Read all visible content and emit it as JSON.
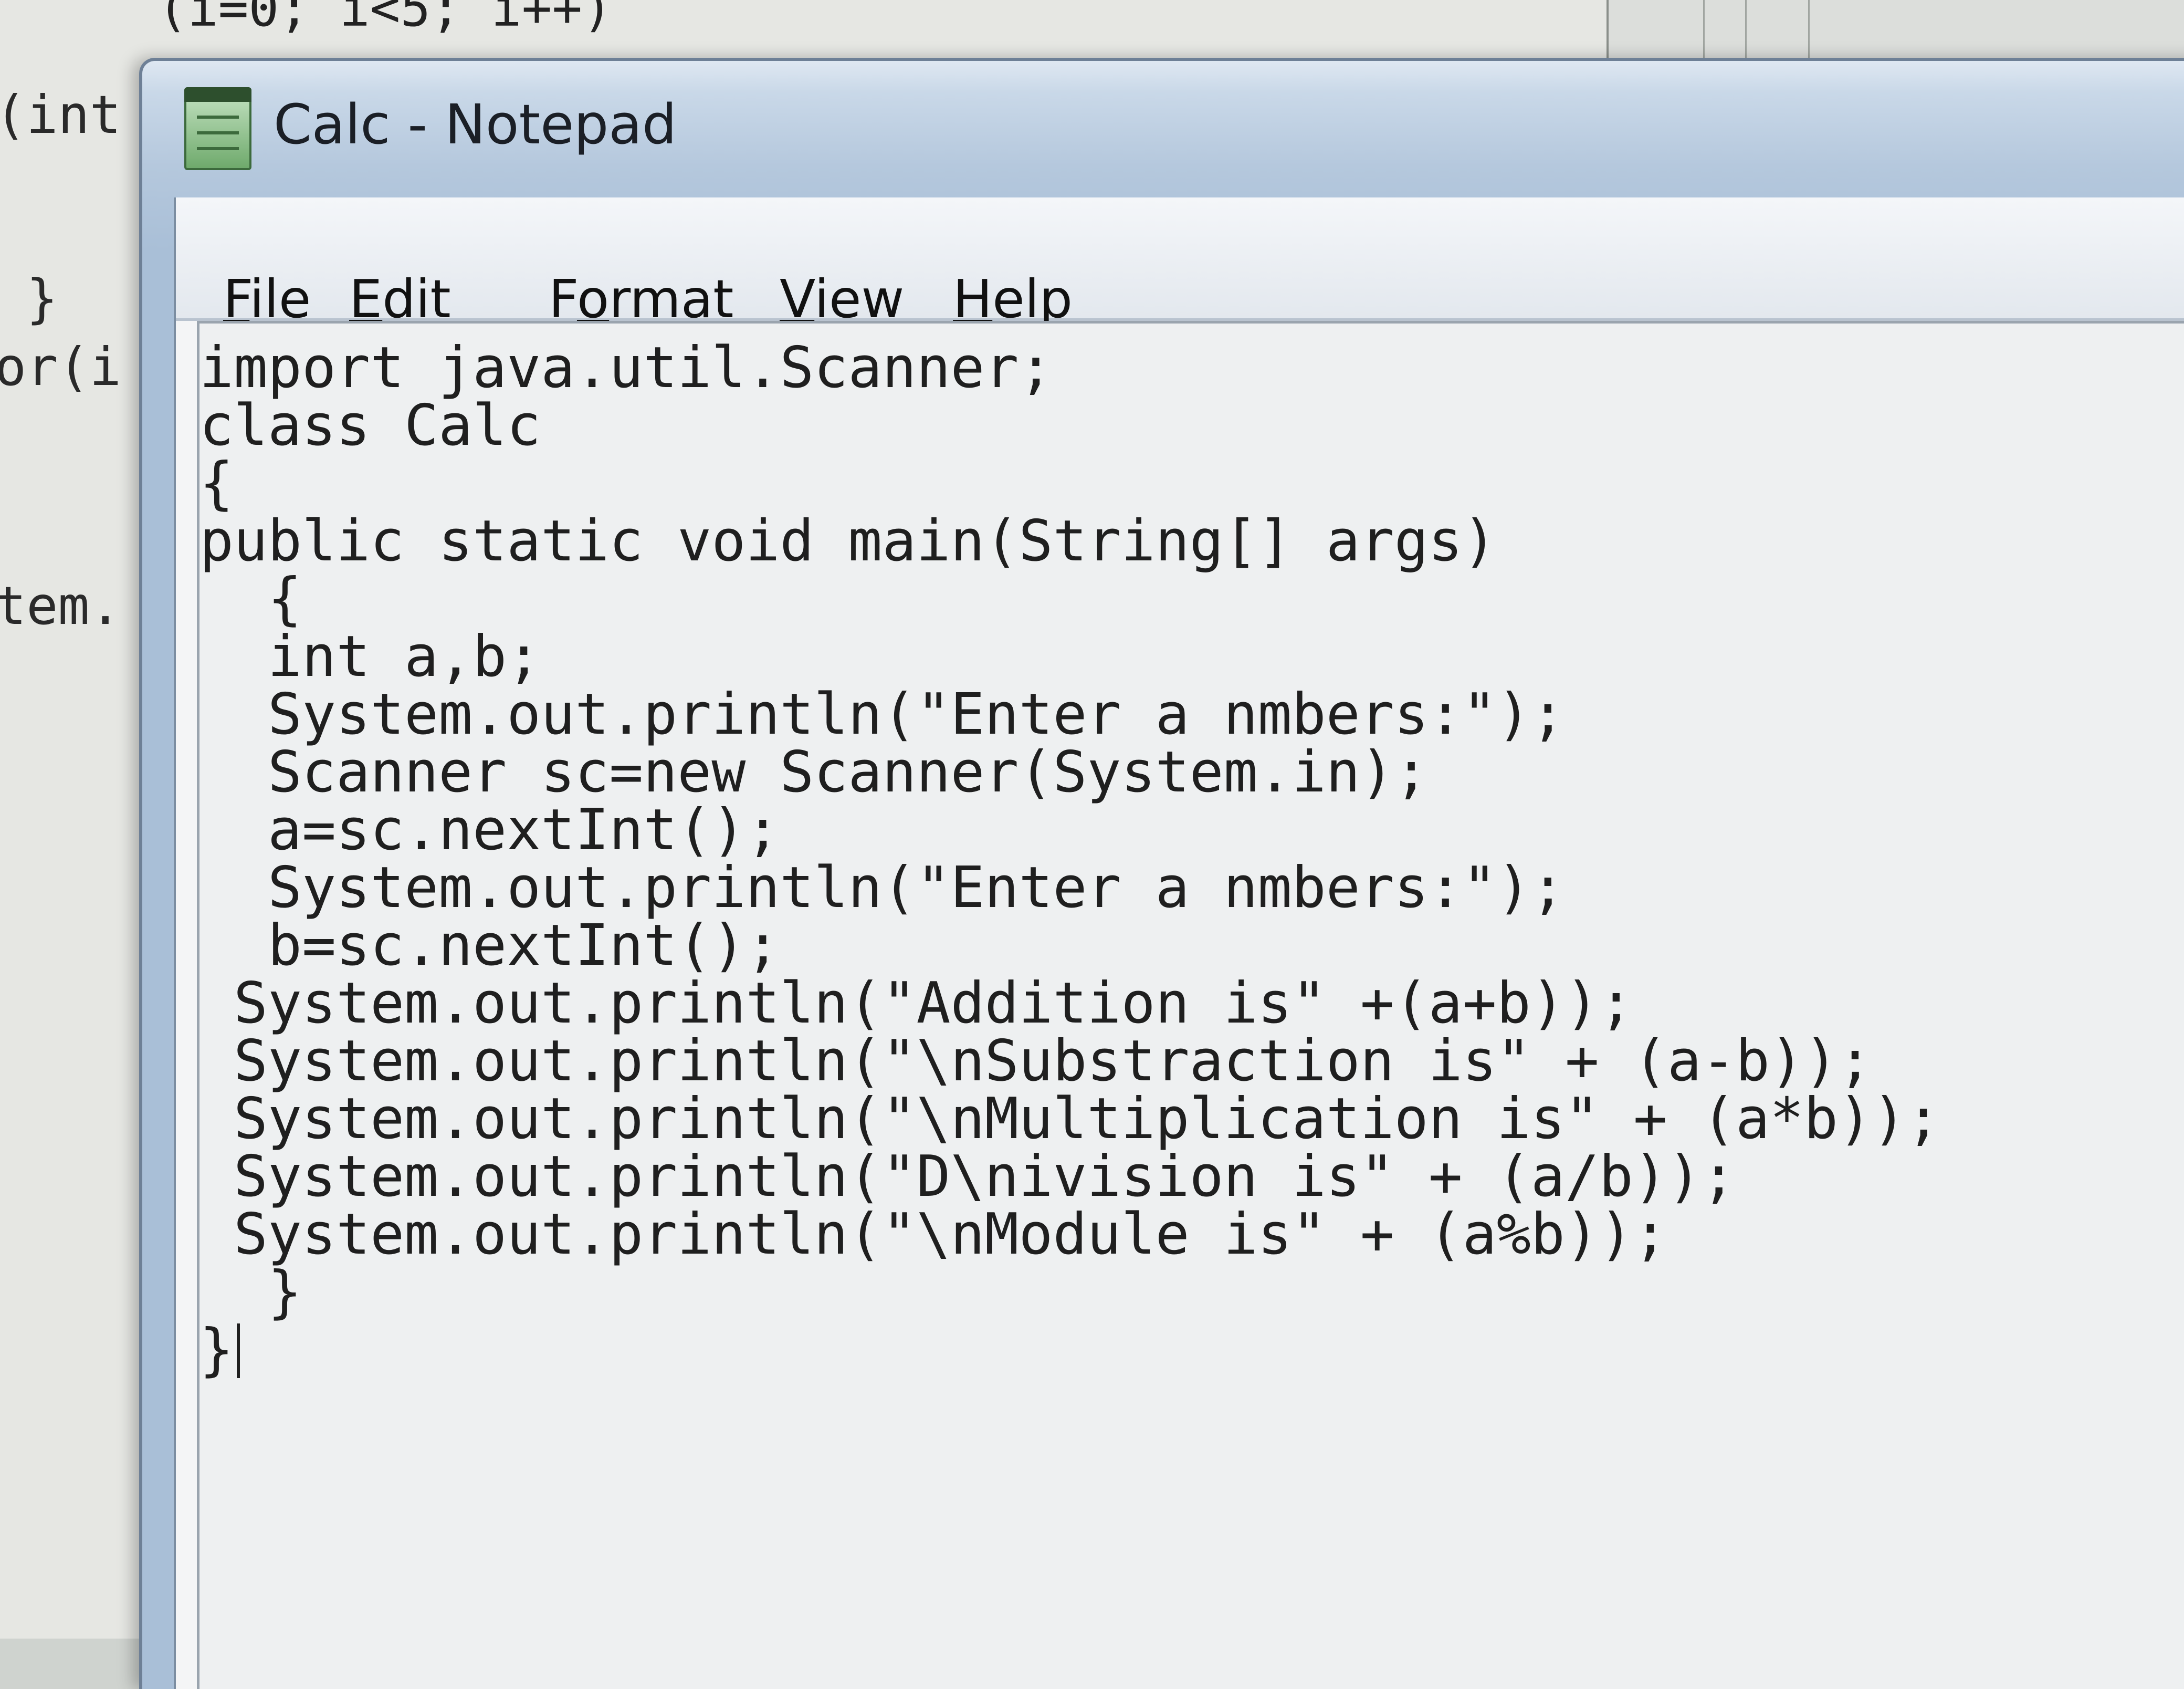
{
  "background_window": {
    "top_code": "(i=0; i<5; i++)",
    "side_fragments": [
      "(int",
      "}",
      "or(i",
      "tem."
    ]
  },
  "window": {
    "title": "Calc - Notepad",
    "icon": "notepad-icon"
  },
  "menu": {
    "items": [
      {
        "label": "File",
        "accel": "F"
      },
      {
        "label": "Edit",
        "accel": "E"
      },
      {
        "label": "Format",
        "accel": "o"
      },
      {
        "label": "View",
        "accel": "V"
      },
      {
        "label": "Help",
        "accel": "H"
      }
    ]
  },
  "editor": {
    "lines": [
      "import java.util.Scanner;",
      "class Calc",
      "{",
      "public static void main(String[] args)",
      "  {",
      "  int a,b;",
      "  System.out.println(\"Enter a nmbers:\");",
      "  Scanner sc=new Scanner(System.in);",
      "  a=sc.nextInt();",
      "  System.out.println(\"Enter a nmbers:\");",
      "  b=sc.nextInt();",
      " System.out.println(\"Addition is\" +(a+b));",
      " System.out.println(\"\\nSubstraction is\" + (a-b));",
      " System.out.println(\"\\nMultiplication is\" + (a*b));",
      " System.out.println(\"D\\nivision is\" + (a/b));",
      " System.out.println(\"\\nModule is\" + (a%b));",
      "  }",
      "}"
    ]
  }
}
